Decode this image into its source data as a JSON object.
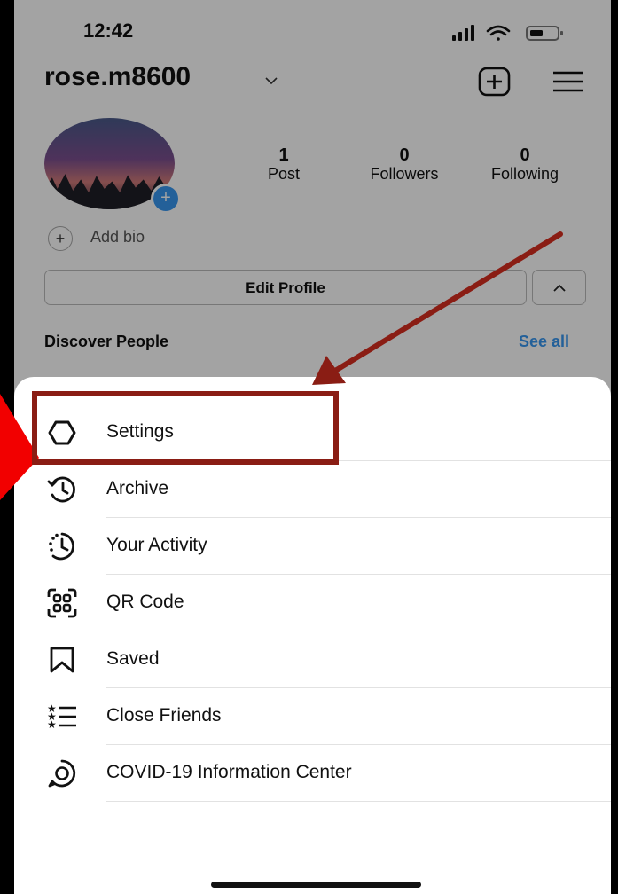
{
  "status_bar": {
    "time": "12:42"
  },
  "profile": {
    "username": "rose.m8600",
    "stats": [
      {
        "value": "1",
        "label": "Post"
      },
      {
        "value": "0",
        "label": "Followers"
      },
      {
        "value": "0",
        "label": "Following"
      }
    ],
    "add_bio": "Add bio",
    "edit_profile": "Edit Profile",
    "discover_people": "Discover People",
    "see_all": "See all"
  },
  "menu": {
    "items": [
      {
        "label": "Settings",
        "icon": "gear-icon"
      },
      {
        "label": "Archive",
        "icon": "archive-clock-icon"
      },
      {
        "label": "Your Activity",
        "icon": "activity-clock-icon"
      },
      {
        "label": "QR Code",
        "icon": "qr-code-icon"
      },
      {
        "label": "Saved",
        "icon": "bookmark-icon"
      },
      {
        "label": "Close Friends",
        "icon": "star-list-icon"
      },
      {
        "label": "COVID-19 Information Center",
        "icon": "info-center-icon"
      }
    ]
  },
  "colors": {
    "accent": "#3897f0",
    "highlight_box": "#8a1d14",
    "pointer": "#f20000"
  }
}
